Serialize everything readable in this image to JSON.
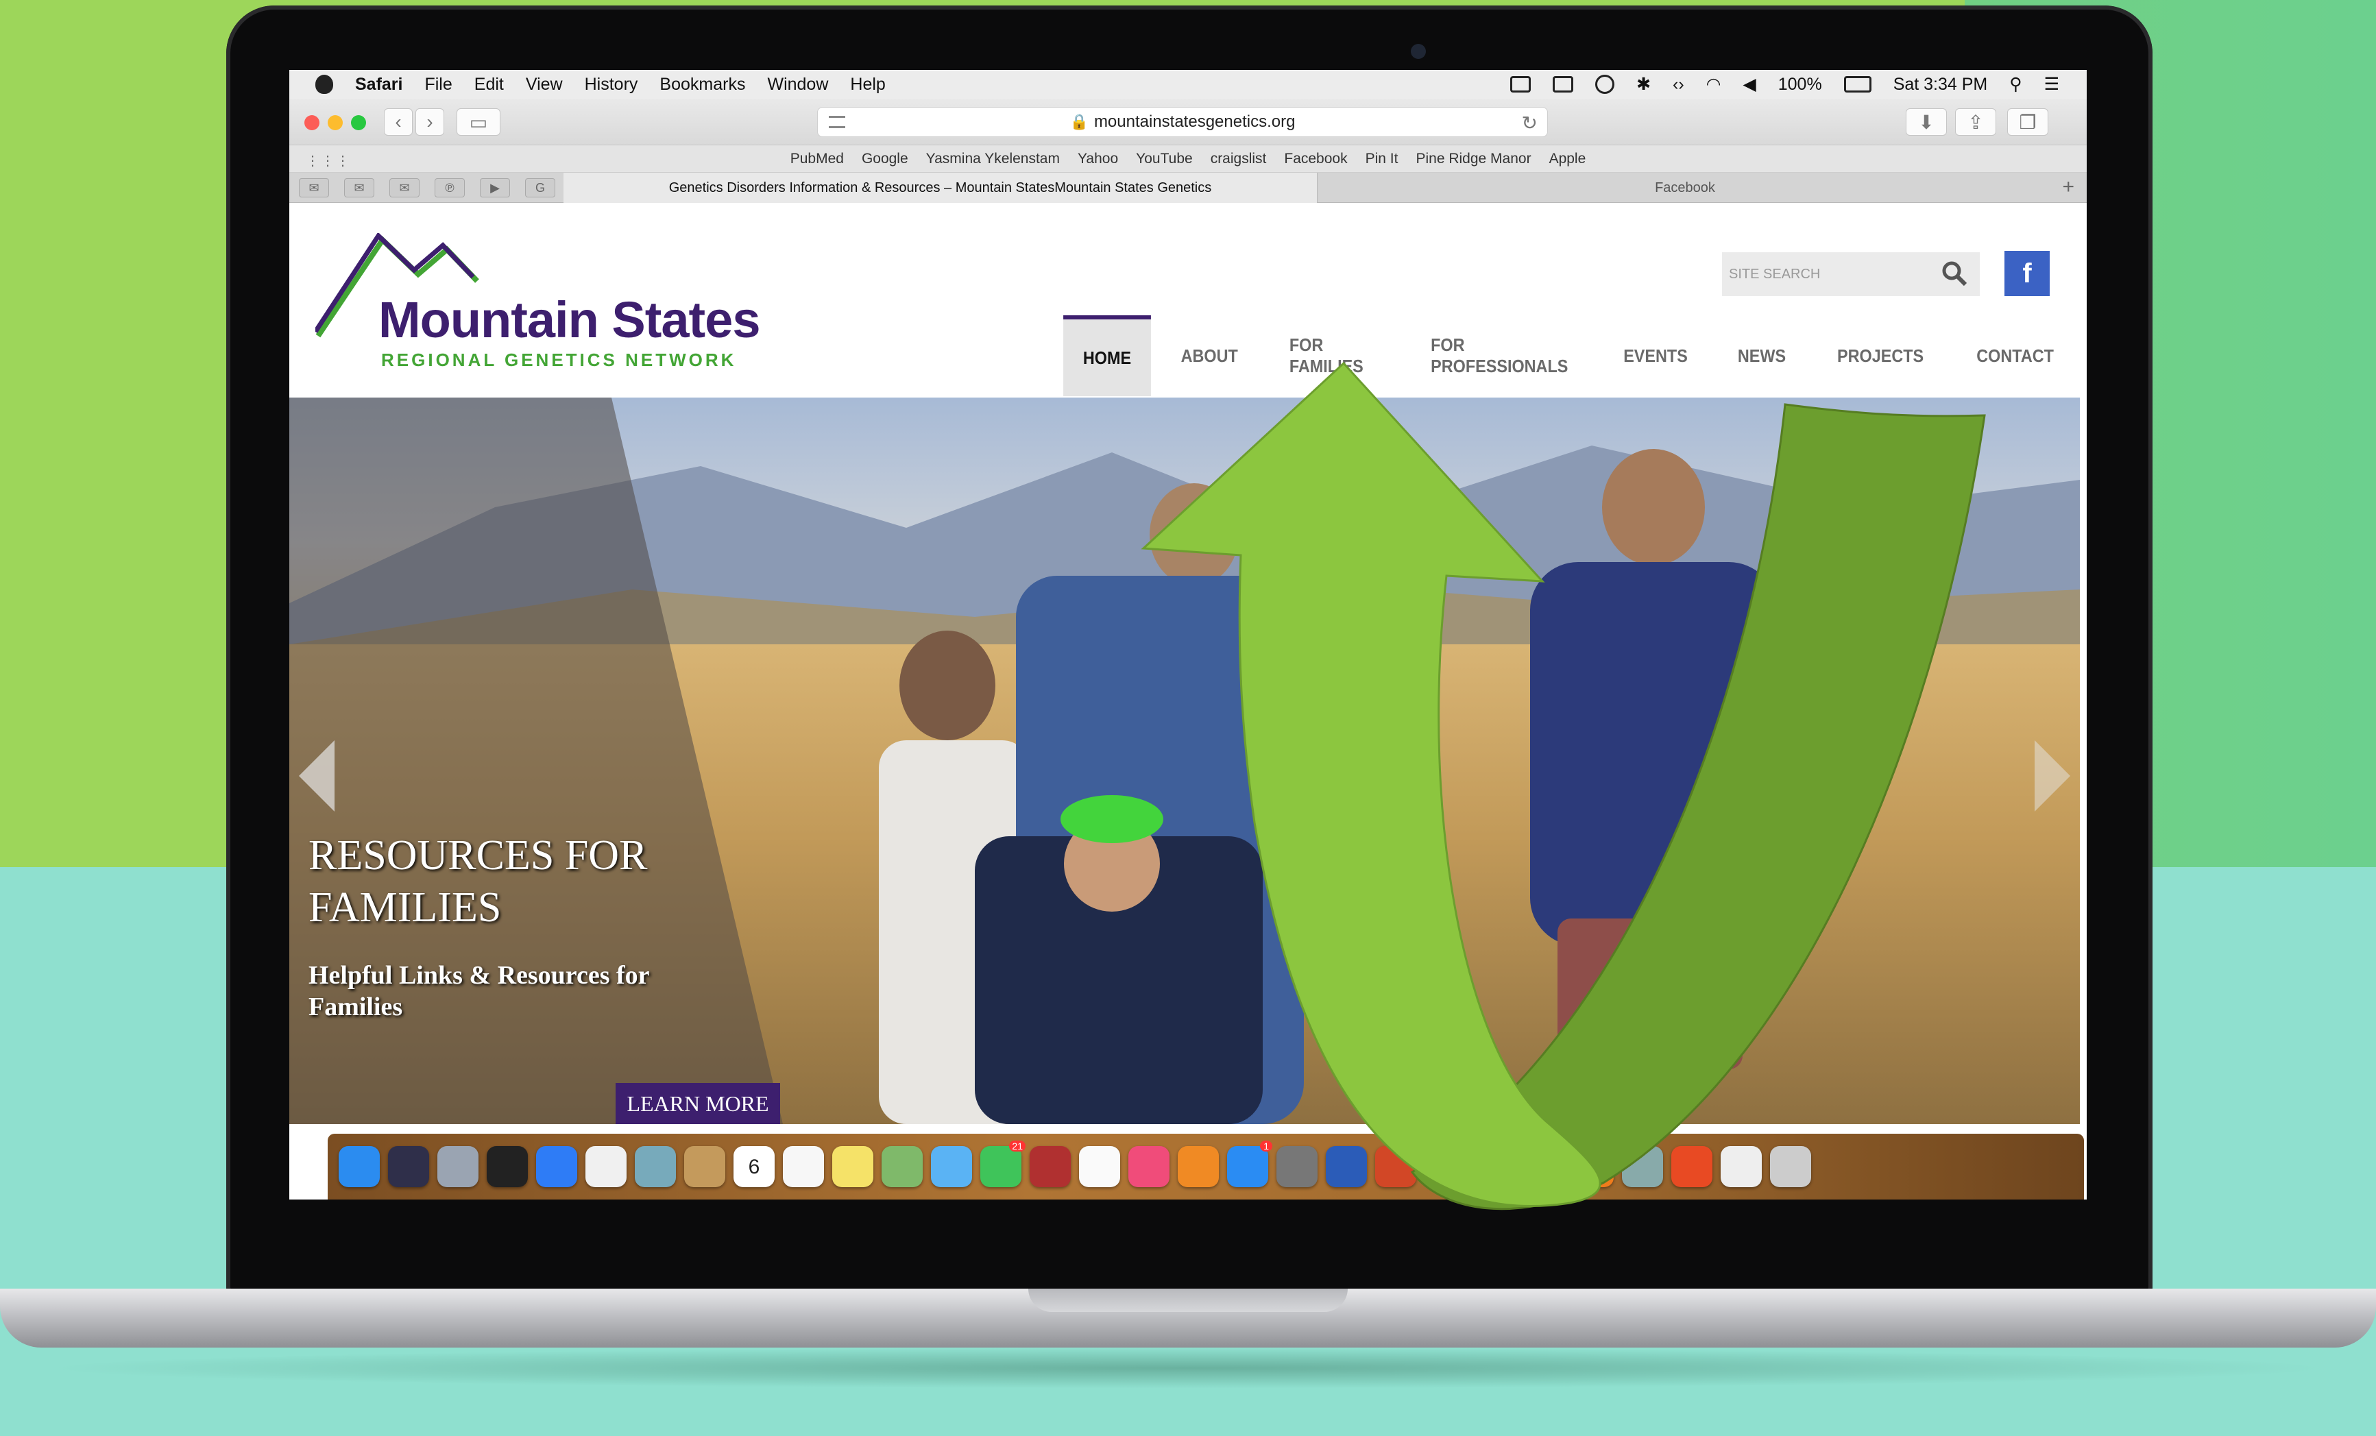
{
  "menubar": {
    "app": "Safari",
    "items": [
      "File",
      "Edit",
      "View",
      "History",
      "Bookmarks",
      "Window",
      "Help"
    ],
    "battery": "100%",
    "clock": "Sat 3:34 PM"
  },
  "toolbar": {
    "url": "mountainstatesgenetics.org",
    "back_glyph": "‹",
    "forward_glyph": "›"
  },
  "favorites": [
    "PubMed",
    "Google",
    "Yasmina Ykelenstam",
    "Yahoo",
    "YouTube",
    "craigslist",
    "Facebook",
    "Pin It",
    "Pine Ridge Manor",
    "Apple"
  ],
  "tabs": {
    "active": "Genetics Disorders Information & Resources – Mountain StatesMountain States Genetics",
    "other": "Facebook"
  },
  "site": {
    "logo_title": "Mountain States",
    "logo_subtitle": "REGIONAL GENETICS NETWORK",
    "search_placeholder": "SITE SEARCH",
    "facebook_label": "f",
    "nav": [
      "HOME",
      "ABOUT",
      "FOR FAMILIES",
      "FOR PROFESSIONALS",
      "EVENTS",
      "NEWS",
      "PROJECTS",
      "CONTACT"
    ],
    "active_nav": "HOME"
  },
  "hero": {
    "title": "RESOURCES FOR FAMILIES",
    "subtitle": "Helpful Links & Resources for Families",
    "cta": "LEARN MORE"
  },
  "dock": {
    "icons": [
      "finder-icon",
      "siri-icon",
      "launchpad-icon",
      "mission-control-icon",
      "safari-icon",
      "chrome-icon",
      "preview-icon",
      "notes-icon",
      "calendar-icon",
      "reminders-icon",
      "stickies-icon",
      "maps-icon",
      "messages-icon",
      "facetime-icon",
      "photo-booth-icon",
      "photos-icon",
      "itunes-icon",
      "ibooks-icon",
      "app-store-icon",
      "system-preferences-icon",
      "word-icon",
      "powerpoint-icon",
      "excel-icon",
      "onenote-icon",
      "scanner-icon",
      "vlc-icon",
      "image-capture-icon",
      "office-icon",
      "documents-icon",
      "trash-icon"
    ],
    "calendar_day": "6",
    "messages_badge": "21",
    "appstore_badge": "1"
  },
  "colors": {
    "brand_purple": "#3d1f6e",
    "brand_green": "#43a535",
    "arrow_green": "#8cc63f",
    "arrow_dark": "#6c9e2e",
    "facebook_blue": "#3b62c4"
  }
}
